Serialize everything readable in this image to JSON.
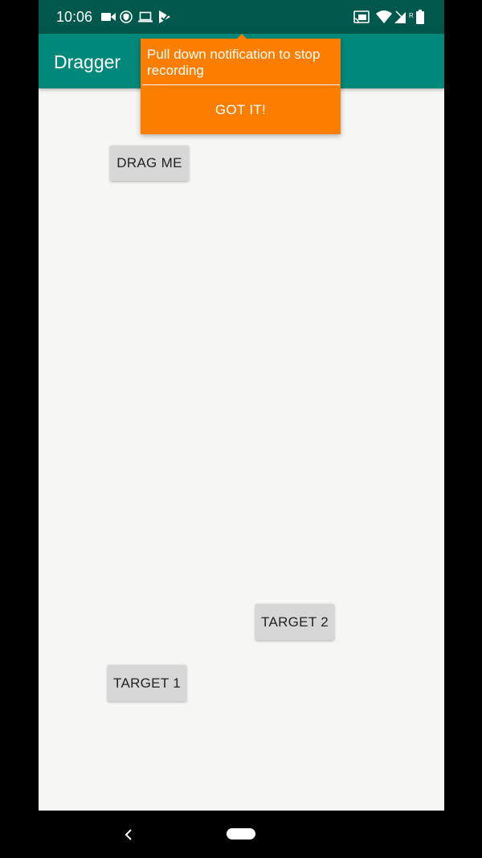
{
  "status_bar": {
    "time": "10:06",
    "icons": [
      "video-camera-icon",
      "vpn-shield-icon",
      "laptop-icon",
      "play-store-icon",
      "cast-icon",
      "wifi-icon",
      "signal-roaming-icon",
      "battery-icon"
    ],
    "signal_badge": "R"
  },
  "app_bar": {
    "title": "Dragger",
    "color": "#00897b"
  },
  "tooltip": {
    "text": "Pull down notification to stop recording",
    "button_label": "GOT IT!",
    "color": "#fb7e00"
  },
  "buttons": {
    "drag_me": "DRAG ME",
    "target_2": "TARGET 2",
    "target_1": "TARGET 1"
  },
  "nav_bar": {
    "icons": [
      "back-icon",
      "home-pill"
    ]
  }
}
